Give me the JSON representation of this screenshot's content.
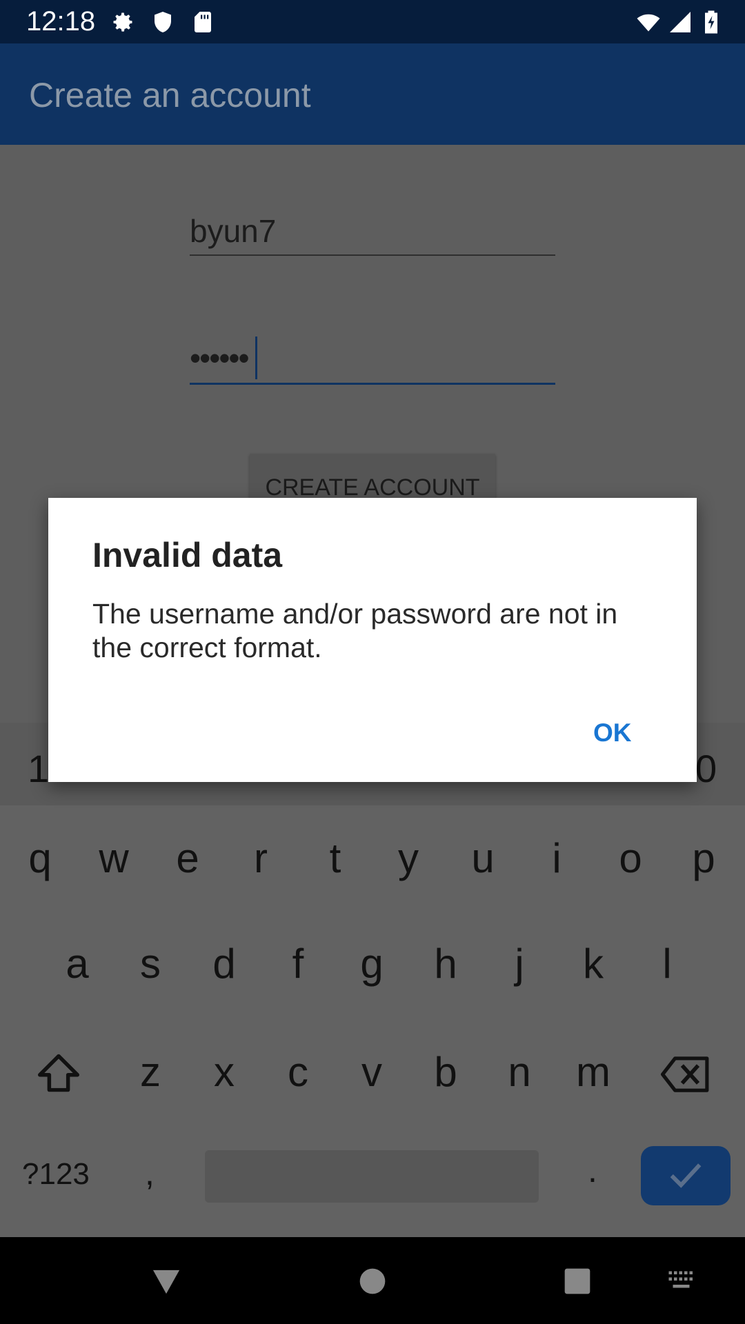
{
  "status_bar": {
    "time": "12:18",
    "left_icons": [
      "gear-icon",
      "shield-icon",
      "sd-card-icon"
    ],
    "right_icons": [
      "wifi-icon",
      "signal-icon",
      "battery-charging-icon"
    ]
  },
  "app_bar": {
    "title": "Create an account"
  },
  "form": {
    "username_value": "byun7",
    "password_value": "••••••",
    "create_button_label": "CREATE ACCOUNT"
  },
  "dialog": {
    "title": "Invalid data",
    "message": "The username and/or password are not in the correct format.",
    "ok_label": "OK"
  },
  "keyboard": {
    "number_row_left": "1",
    "number_row_right": "0",
    "row1": [
      "q",
      "w",
      "e",
      "r",
      "t",
      "y",
      "u",
      "i",
      "o",
      "p"
    ],
    "row2": [
      "a",
      "s",
      "d",
      "f",
      "g",
      "h",
      "j",
      "k",
      "l"
    ],
    "row3": [
      "z",
      "x",
      "c",
      "v",
      "b",
      "n",
      "m"
    ],
    "symbols_label": "?123",
    "comma_label": ",",
    "period_label": "."
  },
  "nav_bar": {
    "icons": [
      "back-icon",
      "home-icon",
      "recents-icon",
      "keyboard-switch-icon"
    ]
  },
  "colors": {
    "app_bar": "#0f3362",
    "status_bar": "#061d3c",
    "accent": "#1976d2",
    "enter_key": "#123a6f"
  }
}
